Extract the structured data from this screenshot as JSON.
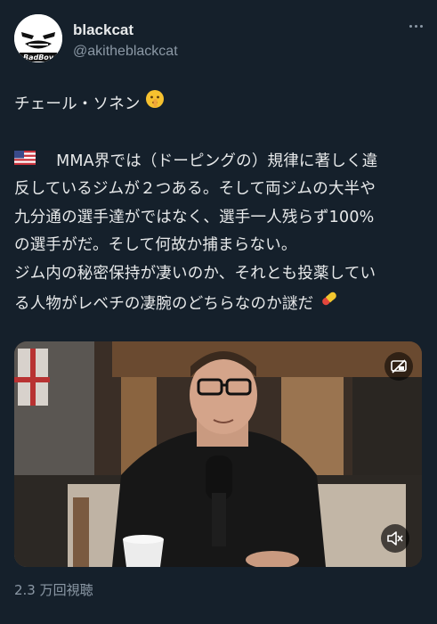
{
  "author": {
    "display_name": "blackcat",
    "handle": "@akitheblackcat",
    "avatar_text": "BadBoy"
  },
  "tweet": {
    "lines": [
      "チェール・ソネン",
      "",
      "MMA界では（ドーピングの）規律に著しく違",
      "反しているジムが２つある。そして両ジムの大半や",
      "九分通の選手達がではなく、選手一人残らず100%",
      "の選手がだ。そして何故か捕まらない。",
      "ジム内の秘密保持が凄いのか、それとも投薬してい",
      "る人物がレベチの凄腕のどちらなのか謎だ"
    ]
  },
  "media": {
    "type": "video"
  },
  "views": "2.3 万回視聴",
  "icons": {
    "more": "more-options-icon",
    "shush_emoji": "shushing-face-emoji",
    "flag_emoji": "us-flag-emoji",
    "pill_emoji": "pill-emoji",
    "pip": "picture-in-picture-icon",
    "mute": "mute-speaker-icon"
  },
  "colors": {
    "background": "#15202b",
    "text": "#e7e9ea",
    "secondary_text": "#8b98a5"
  }
}
